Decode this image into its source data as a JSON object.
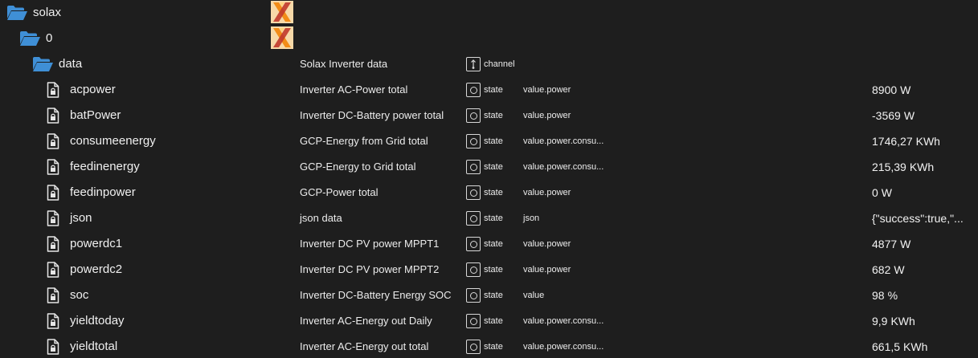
{
  "tree": [
    {
      "key": "solax",
      "name": "solax",
      "kind": "folder",
      "level": 0,
      "logo": true
    },
    {
      "key": "0",
      "name": "0",
      "kind": "folder",
      "level": 1,
      "logo": true
    },
    {
      "key": "data",
      "name": "data",
      "kind": "folder",
      "level": 2,
      "desc": "Solax Inverter data",
      "type": "channel",
      "type_icon": "channel-icon"
    },
    {
      "key": "acpower",
      "name": "acpower",
      "kind": "state",
      "level": 3,
      "desc": "Inverter AC-Power total",
      "type": "state",
      "type_icon": "state-icon",
      "role": "value.power",
      "value": "8900",
      "unit": "W"
    },
    {
      "key": "batPower",
      "name": "batPower",
      "kind": "state",
      "level": 3,
      "desc": "Inverter DC-Battery power total",
      "type": "state",
      "type_icon": "state-icon",
      "role": "value.power",
      "value": "-3569",
      "unit": "W"
    },
    {
      "key": "consumeenergy",
      "name": "consumeenergy",
      "kind": "state",
      "level": 3,
      "desc": "GCP-Energy from Grid total",
      "type": "state",
      "type_icon": "state-icon",
      "role": "value.power.consu...",
      "value": "1746,27",
      "unit": "KWh"
    },
    {
      "key": "feedinenergy",
      "name": "feedinenergy",
      "kind": "state",
      "level": 3,
      "desc": "GCP-Energy to Grid total",
      "type": "state",
      "type_icon": "state-icon",
      "role": "value.power.consu...",
      "value": "215,39",
      "unit": "KWh"
    },
    {
      "key": "feedinpower",
      "name": "feedinpower",
      "kind": "state",
      "level": 3,
      "desc": "GCP-Power total",
      "type": "state",
      "type_icon": "state-icon",
      "role": "value.power",
      "value": "0",
      "unit": "W"
    },
    {
      "key": "json",
      "name": "json",
      "kind": "state",
      "level": 3,
      "desc": "json data",
      "type": "state",
      "type_icon": "state-icon",
      "role": "json",
      "value": "{\"success\":true,\"...",
      "unit": ""
    },
    {
      "key": "powerdc1",
      "name": "powerdc1",
      "kind": "state",
      "level": 3,
      "desc": "Inverter DC PV power MPPT1",
      "type": "state",
      "type_icon": "state-icon",
      "role": "value.power",
      "value": "4877",
      "unit": "W"
    },
    {
      "key": "powerdc2",
      "name": "powerdc2",
      "kind": "state",
      "level": 3,
      "desc": "Inverter DC PV power MPPT2",
      "type": "state",
      "type_icon": "state-icon",
      "role": "value.power",
      "value": "682",
      "unit": "W"
    },
    {
      "key": "soc",
      "name": "soc",
      "kind": "state",
      "level": 3,
      "desc": "Inverter DC-Battery Energy SOC",
      "type": "state",
      "type_icon": "state-icon",
      "role": "value",
      "value": "98",
      "unit": "%"
    },
    {
      "key": "yieldtoday",
      "name": "yieldtoday",
      "kind": "state",
      "level": 3,
      "desc": "Inverter AC-Energy out Daily",
      "type": "state",
      "type_icon": "state-icon",
      "role": "value.power.consu...",
      "value": "9,9",
      "unit": "KWh"
    },
    {
      "key": "yieldtotal",
      "name": "yieldtotal",
      "kind": "state",
      "level": 3,
      "desc": "Inverter AC-Energy out total",
      "type": "state",
      "type_icon": "state-icon",
      "role": "value.power.consu...",
      "value": "661,5",
      "unit": "KWh"
    }
  ],
  "icons": {
    "folder": "folder-open-icon",
    "state": "file-lock-icon",
    "logo": "solax-logo-icon"
  },
  "colors": {
    "background": "#1e1e1e",
    "folder": "#3f8fd6",
    "logo_orange": "#f28c18",
    "logo_red": "#c0392b"
  }
}
